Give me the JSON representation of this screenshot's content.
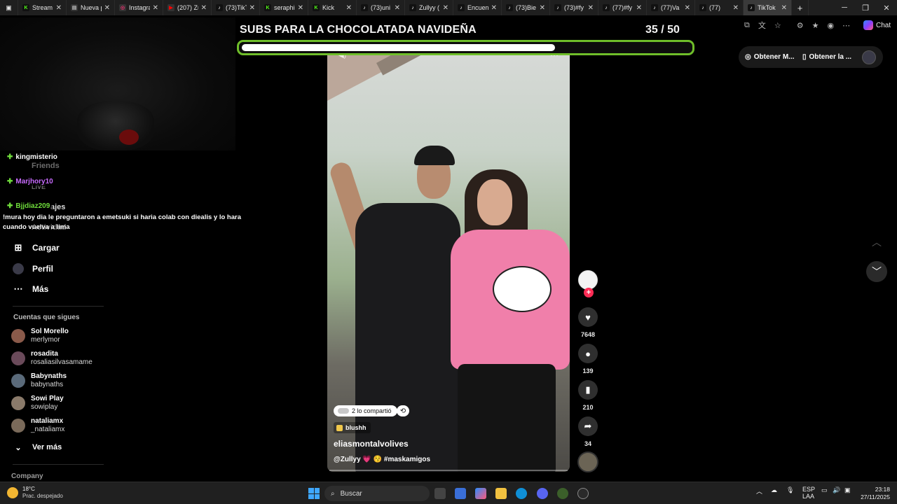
{
  "browser": {
    "tabs": [
      {
        "title": "Stream",
        "icon": "kick-icon",
        "color": "#53fc18",
        "active": false
      },
      {
        "title": "Nueva p",
        "icon": "new-tab-icon",
        "color": "#bbbbbb",
        "active": false
      },
      {
        "title": "Instagra",
        "icon": "instagram-icon",
        "color": "#e1306c",
        "active": false
      },
      {
        "title": "(207) Zu",
        "icon": "youtube-icon",
        "color": "#ff0000",
        "active": false
      },
      {
        "title": "(73)TikT",
        "icon": "tiktok-icon",
        "color": "#ffffff",
        "active": false
      },
      {
        "title": "seraphi",
        "icon": "kick-icon",
        "color": "#53fc18",
        "active": false
      },
      {
        "title": "Kick",
        "icon": "kick-icon",
        "color": "#53fc18",
        "active": false
      },
      {
        "title": "(73)uni",
        "icon": "tiktok-icon",
        "color": "#ffffff",
        "active": false
      },
      {
        "title": "Zullyy (",
        "icon": "tiktok-icon",
        "color": "#ffffff",
        "active": false
      },
      {
        "title": "Encuen",
        "icon": "tiktok-icon",
        "color": "#ffffff",
        "active": false
      },
      {
        "title": "(73)Bie",
        "icon": "tiktok-icon",
        "color": "#ffffff",
        "active": false
      },
      {
        "title": "(73)#fy",
        "icon": "tiktok-icon",
        "color": "#ffffff",
        "active": false
      },
      {
        "title": "(77)#fy",
        "icon": "tiktok-icon",
        "color": "#ffffff",
        "active": false
      },
      {
        "title": "(77)Va",
        "icon": "tiktok-icon",
        "color": "#ffffff",
        "active": false
      },
      {
        "title": "(77)",
        "icon": "tiktok-icon",
        "color": "#ffffff",
        "active": false
      },
      {
        "title": "TikTok",
        "icon": "tiktok-icon",
        "color": "#ffffff",
        "active": true
      }
    ],
    "chat_label": "Chat"
  },
  "overlay": {
    "title": "SUBS PARA LA CHOCOLATADA NAVIDEÑA",
    "count": "35  / 50",
    "progress": 0.7,
    "accent": "#6fbe2a"
  },
  "chat": {
    "messages": [
      {
        "user": "kingmisterio",
        "color": "#ffffff"
      },
      {
        "user": "Marjhory10",
        "color": "#c86bff"
      },
      {
        "user": "Bjjdiaz209",
        "color": "#6fdc3b"
      }
    ],
    "text": "!mura hoy dia le preguntaron a emetsuki si haria colab con diealis y lo hara cuando vuelva a lima"
  },
  "sidebar": {
    "ghost_items": [
      "Friends",
      "LIVE",
      "ajes",
      "Actividad"
    ],
    "items": [
      {
        "label": "Cargar",
        "icon": "upload-icon"
      },
      {
        "label": "Perfil",
        "icon": "profile-icon"
      },
      {
        "label": "Más",
        "icon": "more-icon"
      }
    ],
    "following_title": "Cuentas que sigues",
    "accounts": [
      {
        "name": "Sol Morello",
        "username": "merlymor",
        "color": "#8a5a4a"
      },
      {
        "name": "rosadita",
        "username": "rosaliasilvasamame",
        "color": "#6a4a5a"
      },
      {
        "name": "Babynaths",
        "username": "babynaths",
        "color": "#5a6a7a"
      },
      {
        "name": "Sowi Play",
        "username": "sowiplay",
        "color": "#8a7a6a"
      },
      {
        "name": "nataliamx",
        "username": "_nataliamx",
        "color": "#7a6a5a"
      }
    ],
    "see_more": "Ver más",
    "company": "Company"
  },
  "video": {
    "shared_text": "2 lo compartió",
    "effect": "blushh",
    "author": "eliasmontalvolives",
    "caption": "@Zullyy 💗 😚 #maskamigos",
    "likes": "7648",
    "comments": "139",
    "saves": "210",
    "shares": "34"
  },
  "topright": {
    "btn1": "Obtener M...",
    "btn2": "Obtener la ..."
  },
  "taskbar": {
    "temp": "18°C",
    "weather": "Prac. despejado",
    "search": "Buscar",
    "lang1": "ESP",
    "lang2": "LAA",
    "time": "23:18",
    "date": "27/11/2025"
  }
}
